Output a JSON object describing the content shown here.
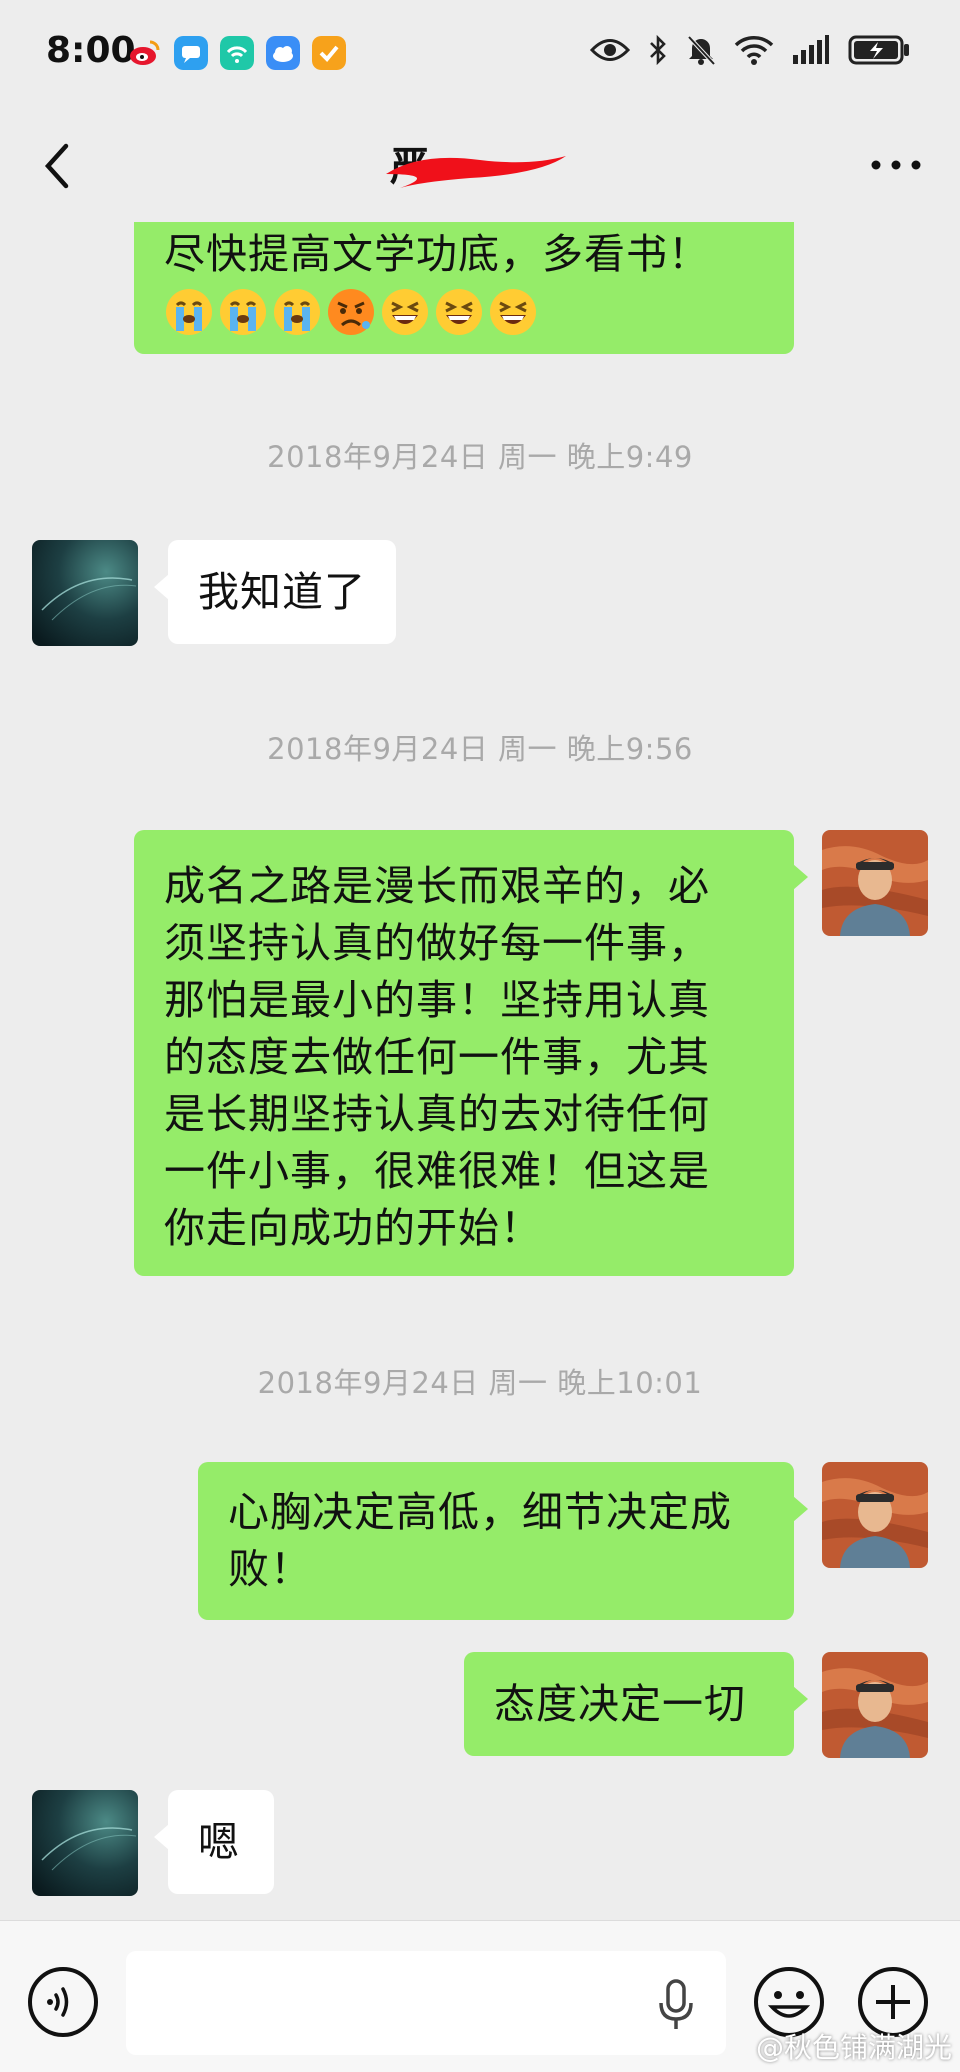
{
  "status_bar": {
    "time": "8:00",
    "icons": [
      "weibo-icon",
      "message-app-icon",
      "wifi-app-icon",
      "cloud-app-icon",
      "task-app-icon",
      "eye-icon",
      "bluetooth-icon",
      "mute-icon",
      "wifi-icon",
      "signal-icon",
      "battery-charging-icon"
    ]
  },
  "header": {
    "title": "严",
    "back_icon": "chevron-left-icon",
    "more_icon": "more-dots-icon"
  },
  "messages": [
    {
      "side": "right",
      "text": "尽快提高文学功底，多看书！",
      "emojis": [
        "crying-face",
        "crying-face",
        "crying-face",
        "angry-face",
        "laughing-face",
        "laughing-face",
        "laughing-face"
      ]
    },
    {
      "type": "timestamp",
      "text": "2018年9月24日 周一 晚上9:49"
    },
    {
      "side": "left",
      "text": "我知道了"
    },
    {
      "type": "timestamp",
      "text": "2018年9月24日 周一 晚上9:56"
    },
    {
      "side": "right",
      "lines": [
        "成名之路是漫长而艰辛的，必",
        "须坚持认真的做好每一件事，",
        "那怕是最小的事！坚持用认真",
        "的态度去做任何一件事，尤其",
        "是长期坚持认真的去对待任何",
        "一件小事，很难很难！但这是",
        "你走向成功的开始！"
      ]
    },
    {
      "type": "timestamp",
      "text": "2018年9月24日 周一 晚上10:01"
    },
    {
      "side": "right",
      "lines": [
        "心胸决定高低，细节决定成",
        "败！"
      ]
    },
    {
      "side": "right",
      "text": "态度决定一切"
    },
    {
      "side": "left",
      "text": "嗯"
    }
  ],
  "input_bar": {
    "voice_icon": "voice-toggle-icon",
    "mic_icon": "microphone-icon",
    "emoji_icon": "emoji-icon",
    "plus_icon": "plus-icon"
  },
  "watermark": "@秋色铺满湖光",
  "colors": {
    "background": "#ededed",
    "sent_bubble": "#95ec69",
    "received_bubble": "#ffffff",
    "timestamp_text": "#a9a9a9"
  }
}
